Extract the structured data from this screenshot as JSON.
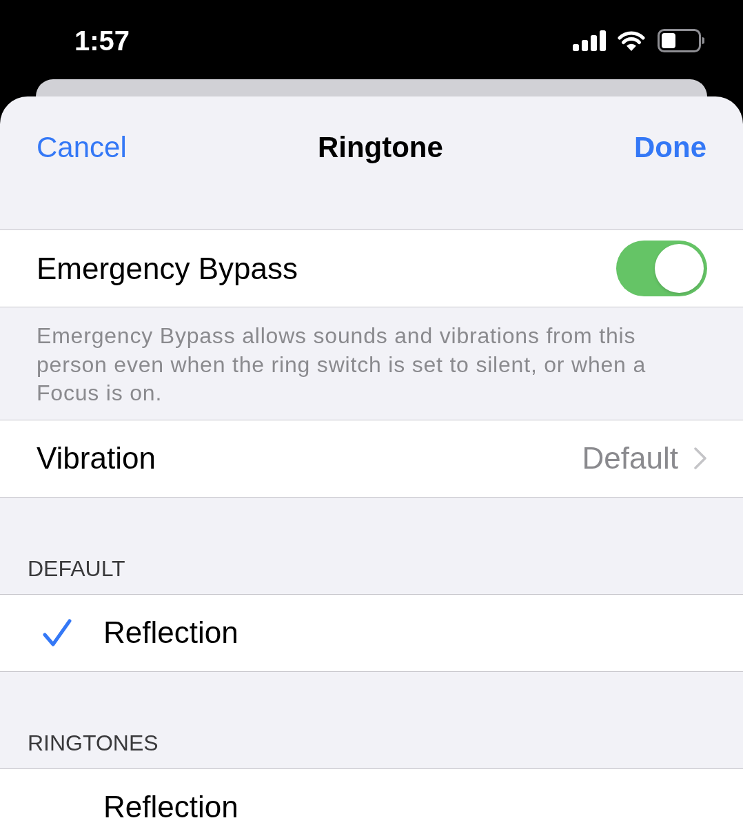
{
  "status_bar": {
    "time": "1:57"
  },
  "nav": {
    "cancel": "Cancel",
    "title": "Ringtone",
    "done": "Done"
  },
  "emergency_bypass": {
    "label": "Emergency Bypass",
    "on": true,
    "footer": "Emergency Bypass allows sounds and vibrations from this person even when the ring switch is set to silent, or when a Focus is on."
  },
  "vibration": {
    "label": "Vibration",
    "value": "Default"
  },
  "sections": [
    {
      "header": "DEFAULT",
      "items": [
        {
          "name": "Reflection",
          "selected": true
        }
      ]
    },
    {
      "header": "RINGTONES",
      "items": [
        {
          "name": "Reflection",
          "selected": false
        }
      ]
    }
  ]
}
